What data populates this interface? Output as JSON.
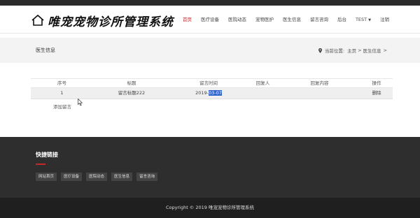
{
  "header": {
    "site_title": "唯宠宠物诊所管理系统",
    "nav": [
      {
        "label": "首页",
        "active": true
      },
      {
        "label": "医疗设备"
      },
      {
        "label": "医院动态"
      },
      {
        "label": "宠物医护"
      },
      {
        "label": "医生信息"
      },
      {
        "label": "留言咨询"
      },
      {
        "label": "后台"
      },
      {
        "label": "TEST"
      },
      {
        "label": "注销"
      }
    ]
  },
  "banner": {
    "title": "医生信息",
    "breadcrumb_prefix": "当前位置:",
    "breadcrumb_home": "主页",
    "breadcrumb_sep1": ">",
    "breadcrumb_current": "医生信息",
    "breadcrumb_sep2": ">"
  },
  "table": {
    "headers": [
      "序号",
      "标题",
      "留言时间",
      "回复人",
      "回复内容",
      "操作"
    ],
    "rows": [
      {
        "no": "1",
        "title": "留言标题222",
        "time_prefix": "2019-",
        "time_selected": "03-07",
        "reply_by": "",
        "reply_content": "",
        "action": "删除"
      }
    ],
    "add_link": "添加留言"
  },
  "footer": {
    "title": "快捷链接",
    "links": [
      "网站首页",
      "医疗设备",
      "医院动态",
      "医生信息",
      "留言咨询"
    ],
    "copyright": "Copyright © 2019 唯宠宠物诊所管理系统"
  },
  "colors": {
    "accent": "#c62828",
    "footer_bg": "#2e2e2e",
    "bottom_bg": "#1f1f1f"
  }
}
